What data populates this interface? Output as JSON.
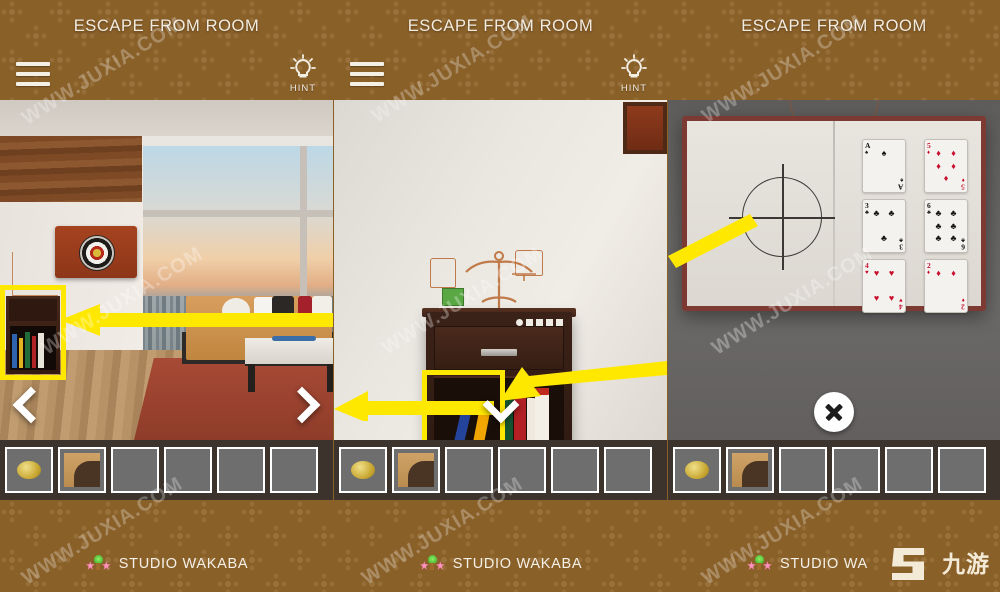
{
  "app": {
    "title": "ESCAPE FROM ROOM",
    "studio_name": "STUDIO WAKABA",
    "studio_name_truncated": "STUDIO WA",
    "brand_watermark": "九游",
    "accent_highlight": "#ffe800",
    "header_bg": "#8a6029",
    "inventory_bg": "#3b332c",
    "slot_bg": "#6e6e6e"
  },
  "watermarks": {
    "texts": [
      "WWW.JUXIA.COM",
      "WWW.JUXIA.COM",
      "WWW.JUXIA.COM",
      "WWW.JUXIA.COM",
      "WWW.JUXIA.COM",
      "WWW.JUXIA.COM"
    ]
  },
  "header": {
    "menu_icon": "hamburger-menu-icon",
    "hint_icon": "lightbulb-hint-icon",
    "hint_label": "HINT"
  },
  "panels": [
    {
      "id": "panel-1",
      "title": "ESCAPE FROM ROOM",
      "has_menu": true,
      "has_hint": true,
      "scene_name": "living-room-wide-view",
      "nav": {
        "left": "chevron-left-icon",
        "right": "chevron-right-icon"
      },
      "highlight_target": "bookshelf-cabinet",
      "arrow_direction": "left",
      "inventory": [
        {
          "name": "gold-coin",
          "filled": true,
          "kind": "coin"
        },
        {
          "name": "stone-arch-fragment",
          "filled": true,
          "kind": "tunnel"
        },
        {
          "name": "empty-slot-3",
          "filled": false,
          "kind": ""
        },
        {
          "name": "empty-slot-4",
          "filled": false,
          "kind": ""
        },
        {
          "name": "empty-slot-5",
          "filled": false,
          "kind": ""
        },
        {
          "name": "empty-slot-6",
          "filled": false,
          "kind": ""
        }
      ],
      "studio": "STUDIO WAKABA"
    },
    {
      "id": "panel-2",
      "title": "ESCAPE FROM ROOM",
      "has_menu": true,
      "has_hint": true,
      "scene_name": "cabinet-close-up",
      "nav": {
        "down": "chevron-down-icon"
      },
      "highlight_target": "blue-and-yellow-books",
      "arrow_direction": "left-down",
      "inventory": [
        {
          "name": "gold-coin",
          "filled": true,
          "kind": "coin"
        },
        {
          "name": "stone-arch-fragment",
          "filled": true,
          "kind": "tunnel"
        },
        {
          "name": "empty-slot-3",
          "filled": false,
          "kind": ""
        },
        {
          "name": "empty-slot-4",
          "filled": false,
          "kind": ""
        },
        {
          "name": "empty-slot-5",
          "filled": false,
          "kind": ""
        },
        {
          "name": "empty-slot-6",
          "filled": false,
          "kind": ""
        }
      ],
      "studio": "STUDIO WAKABA"
    },
    {
      "id": "panel-3",
      "title": "ESCAPE FROM ROOM",
      "has_menu": false,
      "has_hint": false,
      "scene_name": "open-book-with-playing-cards",
      "nav": {
        "close": "close-x-icon"
      },
      "book": {
        "left_page_symbol": "crosshair-circle",
        "cards": [
          {
            "rank": "A",
            "suit": "spades",
            "suit_glyph": "♠",
            "color": "black",
            "pips": 1
          },
          {
            "rank": "5",
            "suit": "diamonds",
            "suit_glyph": "♦",
            "color": "red",
            "pips": 5
          },
          {
            "rank": "3",
            "suit": "clubs",
            "suit_glyph": "♣",
            "color": "black",
            "pips": 3
          },
          {
            "rank": "6",
            "suit": "clubs",
            "suit_glyph": "♣",
            "color": "black",
            "pips": 6
          },
          {
            "rank": "4",
            "suit": "hearts",
            "suit_glyph": "♥",
            "color": "red",
            "pips": 4
          },
          {
            "rank": "2",
            "suit": "diamonds",
            "suit_glyph": "♦",
            "color": "red",
            "pips": 2
          }
        ]
      },
      "inventory": [
        {
          "name": "gold-coin",
          "filled": true,
          "kind": "coin"
        },
        {
          "name": "stone-arch-fragment",
          "filled": true,
          "kind": "tunnel"
        },
        {
          "name": "empty-slot-3",
          "filled": false,
          "kind": ""
        },
        {
          "name": "empty-slot-4",
          "filled": false,
          "kind": ""
        },
        {
          "name": "empty-slot-5",
          "filled": false,
          "kind": ""
        },
        {
          "name": "empty-slot-6",
          "filled": false,
          "kind": ""
        }
      ],
      "studio": "STUDIO WA"
    }
  ]
}
